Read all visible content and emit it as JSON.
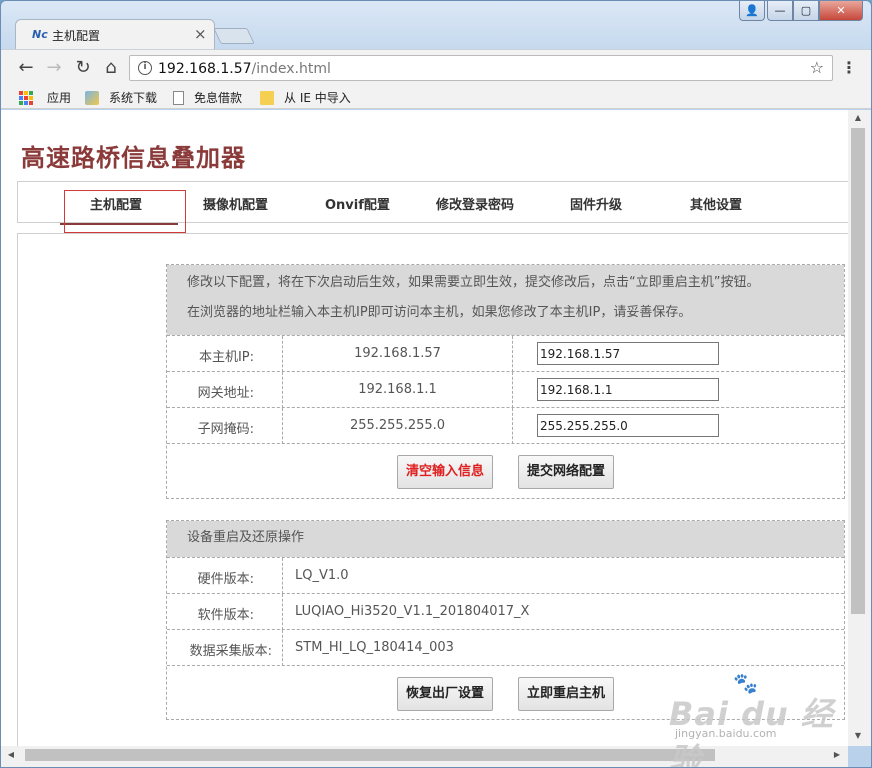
{
  "browser": {
    "tab_title": "主机配置",
    "tab_favicon": "Nc",
    "url_host": "192.168.1.57",
    "url_path": "/index.html",
    "bookmarks": [
      {
        "label": "应用",
        "icon": "apps-grid-icon"
      },
      {
        "label": "系统下载",
        "icon": "image-icon"
      },
      {
        "label": "免息借款",
        "icon": "document-icon"
      },
      {
        "label": "从 IE 中导入",
        "icon": "folder-icon"
      }
    ]
  },
  "page": {
    "site_title": "高速路桥信息叠加器",
    "nav": [
      "主机配置",
      "摄像机配置",
      "Onvif配置",
      "修改登录密码",
      "固件升级",
      "其他设置"
    ],
    "active_nav": "主机配置",
    "accent_color": "#8b3a3a"
  },
  "network_panel": {
    "notice_line1": "修改以下配置，将在下次启动后生效，如果需要立即生效，提交修改后，点击“立即重启主机”按钮。",
    "notice_line2": "在浏览器的地址栏输入本主机IP即可访问本主机，如果您修改了本主机IP，请妥善保存。",
    "rows": [
      {
        "label": "本主机IP:",
        "current": "192.168.1.57",
        "input": "192.168.1.57"
      },
      {
        "label": "网关地址:",
        "current": "192.168.1.1",
        "input": "192.168.1.1"
      },
      {
        "label": "子网掩码:",
        "current": "255.255.255.0",
        "input": "255.255.255.0"
      }
    ],
    "clear_button": "清空输入信息",
    "submit_button": "提交网络配置"
  },
  "device_panel": {
    "header": "设备重启及还原操作",
    "rows": [
      {
        "label": "硬件版本:",
        "value": "LQ_V1.0"
      },
      {
        "label": "软件版本:",
        "value": "LUQIAO_Hi3520_V1.1_201804017_X"
      },
      {
        "label": "数据采集版本:",
        "value": "STM_HI_LQ_180414_003"
      }
    ],
    "restore_button": "恢复出厂设置",
    "reboot_button": "立即重启主机"
  },
  "watermark": {
    "main": "Bai du 经验",
    "sub": "jingyan.baidu.com"
  }
}
